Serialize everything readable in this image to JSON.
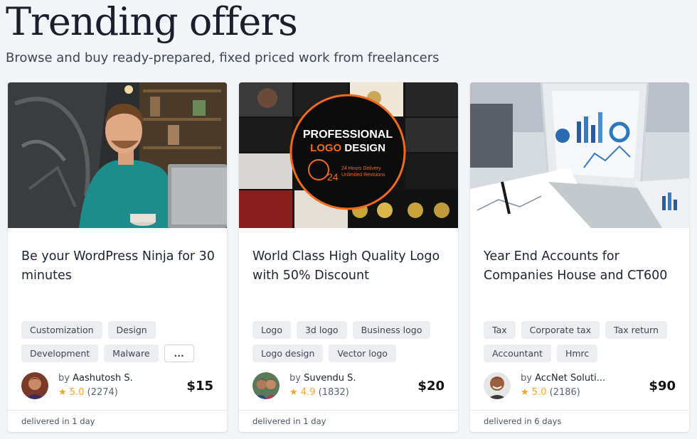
{
  "page": {
    "title": "Trending offers",
    "subtitle": "Browse and buy ready-prepared, fixed priced work from freelancers"
  },
  "cards": [
    {
      "title": "Be your WordPress Ninja for 30 minutes",
      "tags": [
        "Customization",
        "Design",
        "Development",
        "Malware"
      ],
      "more_label": "...",
      "by_prefix": "by",
      "seller": "Aashutosh S.",
      "star": "★",
      "rating": "5.0",
      "reviews": "(2274)",
      "price": "$15",
      "delivery": "delivered in 1 day"
    },
    {
      "title": "World Class High Quality Logo with 50% Discount",
      "tags": [
        "Logo",
        "3d logo",
        "Business logo",
        "Logo design",
        "Vector logo"
      ],
      "by_prefix": "by",
      "seller": "Suvendu S.",
      "star": "★",
      "rating": "4.9",
      "reviews": "(1832)",
      "price": "$20",
      "delivery": "delivered in 1 day",
      "image_text": {
        "line1": "PROFESSIONAL",
        "line2a": "LOGO",
        "line2b": " DESIGN",
        "num": "24",
        "note1": "24 Hours Delivery",
        "note2": "Unlimited Revisions"
      }
    },
    {
      "title": "Year End Accounts for Companies House and CT600",
      "tags": [
        "Tax",
        "Corporate tax",
        "Tax return",
        "Accountant",
        "Hmrc"
      ],
      "by_prefix": "by",
      "seller": "AccNet Soluti...",
      "star": "★",
      "rating": "5.0",
      "reviews": "(2186)",
      "price": "$90",
      "delivery": "delivered in 6 days"
    }
  ],
  "colors": {
    "star": "#f5a623",
    "background": "#f3f5f8",
    "logo_accent": "#f26a1b"
  }
}
